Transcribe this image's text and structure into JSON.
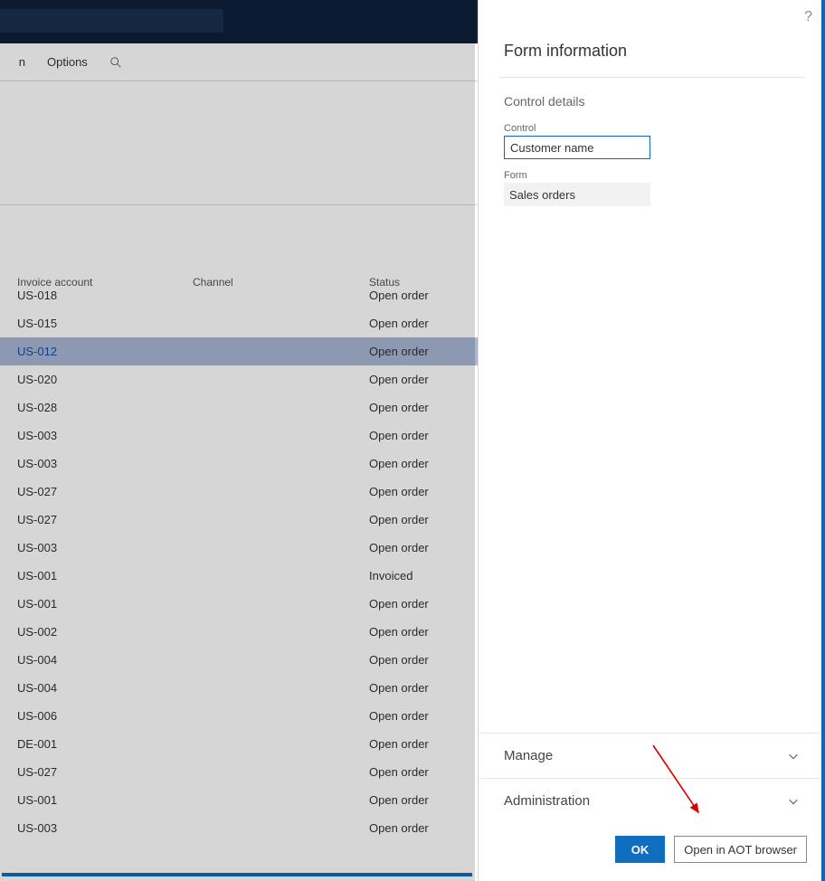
{
  "cmdbar": {
    "options_label": "Options",
    "partial_label": "n"
  },
  "grid": {
    "headers": {
      "invoice": "Invoice account",
      "channel": "Channel",
      "status": "Status"
    },
    "rows": [
      {
        "invoice": "US-018",
        "status": "Open order",
        "selected": false
      },
      {
        "invoice": "US-015",
        "status": "Open order",
        "selected": false
      },
      {
        "invoice": "US-012",
        "status": "Open order",
        "selected": true
      },
      {
        "invoice": "US-020",
        "status": "Open order",
        "selected": false
      },
      {
        "invoice": "US-028",
        "status": "Open order",
        "selected": false
      },
      {
        "invoice": "US-003",
        "status": "Open order",
        "selected": false
      },
      {
        "invoice": "US-003",
        "status": "Open order",
        "selected": false
      },
      {
        "invoice": "US-027",
        "status": "Open order",
        "selected": false
      },
      {
        "invoice": "US-027",
        "status": "Open order",
        "selected": false
      },
      {
        "invoice": "US-003",
        "status": "Open order",
        "selected": false
      },
      {
        "invoice": "US-001",
        "status": "Invoiced",
        "selected": false
      },
      {
        "invoice": "US-001",
        "status": "Open order",
        "selected": false
      },
      {
        "invoice": "US-002",
        "status": "Open order",
        "selected": false
      },
      {
        "invoice": "US-004",
        "status": "Open order",
        "selected": false
      },
      {
        "invoice": "US-004",
        "status": "Open order",
        "selected": false
      },
      {
        "invoice": "US-006",
        "status": "Open order",
        "selected": false
      },
      {
        "invoice": "DE-001",
        "status": "Open order",
        "selected": false
      },
      {
        "invoice": "US-027",
        "status": "Open order",
        "selected": false
      },
      {
        "invoice": "US-001",
        "status": "Open order",
        "selected": false
      },
      {
        "invoice": "US-003",
        "status": "Open order",
        "selected": false
      }
    ]
  },
  "panel": {
    "title": "Form information",
    "section_control_details": "Control details",
    "control_label": "Control",
    "control_value": "Customer name",
    "form_label": "Form",
    "form_value": "Sales orders",
    "accordion_manage": "Manage",
    "accordion_admin": "Administration",
    "ok_label": "OK",
    "aot_label": "Open in AOT browser"
  }
}
